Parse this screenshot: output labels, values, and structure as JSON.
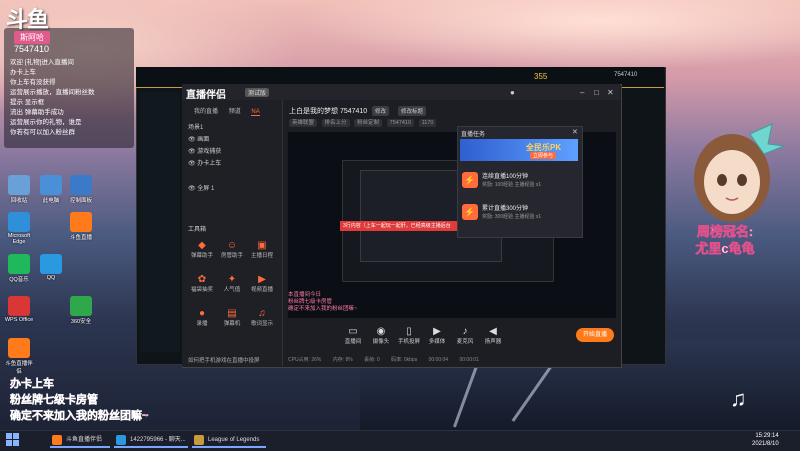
{
  "overlay": {
    "logo": "斗鱼",
    "user_name": "斯阿哈",
    "user_id": "7547410",
    "chat": [
      "欢迎 [礼物]进入直播间",
      "办卡上车",
      "你上车有没获得",
      "运营展示播放，直播间粉丝数",
      "提示 显示框",
      "流出 弹幕助手成功",
      "运营展示你的礼物，谁是",
      "你若有可以加入粉丝群"
    ],
    "pink_lines": [
      "办卡上车",
      "粉丝牌七级卡房管",
      "确定不来加入我的粉丝团嘛~"
    ],
    "rank_text": "周榜冠名:\n尤里c龟龟"
  },
  "desktop_icons": [
    {
      "label": "回收站",
      "color": "#6aa0d8"
    },
    {
      "label": "此电脑",
      "color": "#4a90d8"
    },
    {
      "label": "控制面板",
      "color": "#3a7ac8"
    },
    {
      "label": "Microsoft Edge",
      "color": "#2f8fd8"
    },
    {
      "label": "斗鱼直播",
      "color": "#ff7a1a"
    },
    {
      "label": "QQ音乐",
      "color": "#1fb85a"
    },
    {
      "label": "QQ",
      "color": "#2a9ae0"
    },
    {
      "label": "WPS Office",
      "color": "#d93636"
    },
    {
      "label": "360安全",
      "color": "#2ea84a"
    },
    {
      "label": "斗鱼直播伴侣",
      "color": "#ff7a1a"
    }
  ],
  "game": {
    "currency1": "355",
    "currency2": "7547410"
  },
  "companion": {
    "logo": "直播伴侣",
    "version": "测试版",
    "tabs": [
      "我的直播",
      "频道",
      "NA"
    ],
    "active_tab": 2,
    "scenes": [
      "场景1",
      "画面",
      "游戏捕获",
      "办卡上车",
      "全屏 1"
    ],
    "tools_title": "工具箱",
    "tools": [
      {
        "label": "弹幕助手",
        "icon": "◆"
      },
      {
        "label": "房管助手",
        "icon": "☺"
      },
      {
        "label": "主播日程",
        "icon": "▣"
      },
      {
        "label": "福袋抽奖",
        "icon": "✿"
      },
      {
        "label": "人气值",
        "icon": "✦"
      },
      {
        "label": "视频直播",
        "icon": "▶"
      },
      {
        "label": "录播",
        "icon": "●"
      },
      {
        "label": "弹幕机",
        "icon": "▤"
      },
      {
        "label": "歌词显示",
        "icon": "♫"
      }
    ],
    "stream_title": "上白是我的梦想 7547410",
    "edit_label": "修改",
    "edit2_label": "修改标题",
    "tags": [
      "英雄联盟",
      "排名上分",
      "粉丝定制",
      "7547410",
      "1170"
    ],
    "notice": "如何把手机游戏在直播中投屏",
    "preview_red": "3行内容（上车一起玩一起肝，已经高级主播后台",
    "preview_pink": [
      "本直播间今日",
      "粉丝牌七级卡房管",
      "确定不来加入我的粉丝团嘛~"
    ],
    "bottom_buttons": [
      "直播间",
      "摄像头",
      "手机投屏",
      "多媒体",
      "麦克风",
      "扬声器"
    ],
    "go_live": "开始直播",
    "status": [
      "CPU占用: 26%",
      "内存: 8%",
      "丢帧: 0",
      "码率: 0kbps",
      "00:00:04",
      "00:00:01"
    ]
  },
  "tasks": {
    "header": "直播任务",
    "banner_title": "全民乐PK",
    "banner_btn": "立即参与",
    "items": [
      {
        "name": "连续直播100分钟",
        "desc": "奖励: 100经验 主播经验 x1"
      },
      {
        "name": "累计直播300分钟",
        "desc": "奖励: 300经验 主播经验 x1"
      }
    ]
  },
  "taskbar": {
    "items": [
      {
        "label": "斗鱼直播伴侣",
        "color": "#ff7a1a"
      },
      {
        "label": "1422795966 - 聊天...",
        "color": "#2a9ae0"
      },
      {
        "label": "League of Legends",
        "color": "#c89b3c"
      }
    ],
    "time": "15:29:14",
    "date": "2021/8/10"
  }
}
